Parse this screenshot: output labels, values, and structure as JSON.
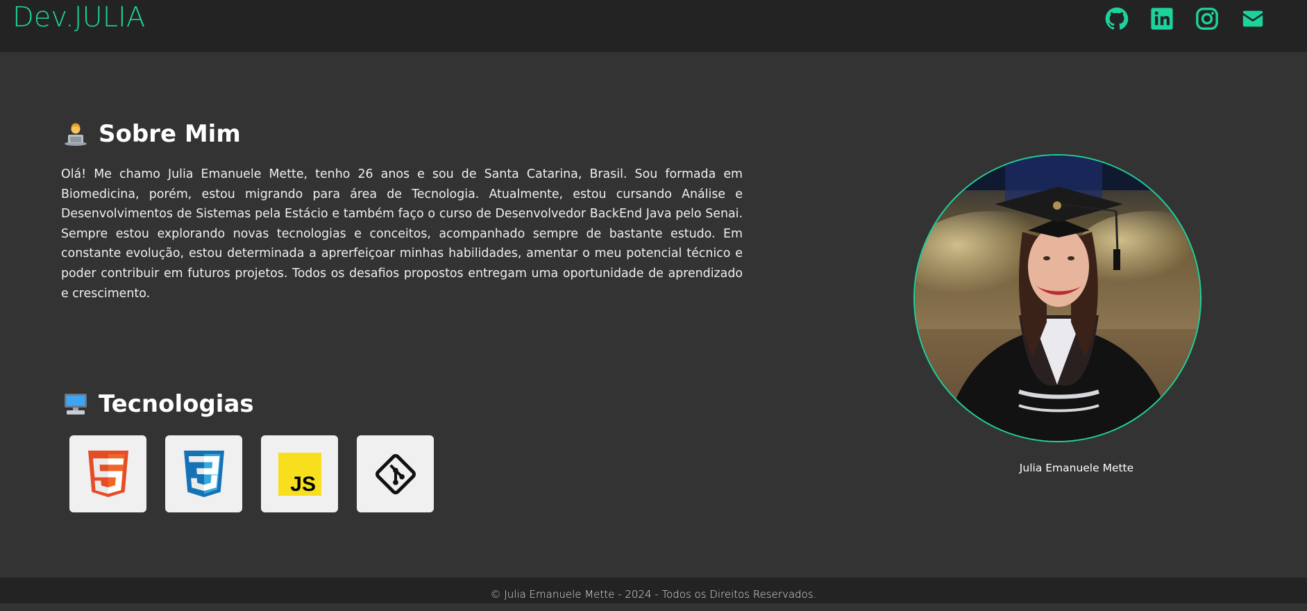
{
  "header": {
    "logo": "Dev.JULIA",
    "social": [
      {
        "icon": "github-icon",
        "label": "GitHub"
      },
      {
        "icon": "linkedin-icon",
        "label": "LinkedIn"
      },
      {
        "icon": "instagram-icon",
        "label": "Instagram"
      },
      {
        "icon": "mail-icon",
        "label": "Email"
      }
    ]
  },
  "about": {
    "emoji": "technologist-emoji",
    "title": "Sobre Mim",
    "text": "Olá! Me chamo Julia Emanuele Mette, tenho 26 anos e sou de Santa Catarina, Brasil. Sou formada em Biomedicina, porém, estou migrando para área de Tecnologia. Atualmente, estou cursando Análise e Desenvolvimentos de Sistemas pela Estácio e também faço o curso de Desenvolvedor BackEnd Java pelo Senai. Sempre estou explorando novas tecnologias e conceitos, acompanhado sempre de bastante estudo. Em constante evolução, estou determinada a aprerfeiçoar minhas habilidades, amentar o meu potencial técnico e poder contribuir em futuros projetos. Todos os desafios propostos entregam uma oportunidade de aprendizado e crescimento."
  },
  "technologies": {
    "emoji": "computer-emoji",
    "title": "Tecnologias",
    "items": [
      {
        "icon": "html5-icon"
      },
      {
        "icon": "css3-icon"
      },
      {
        "icon": "javascript-icon"
      },
      {
        "icon": "git-icon"
      }
    ]
  },
  "profile": {
    "caption": "Julia Emanuele Mette"
  },
  "footer": {
    "text": "© Julia Emanuele Mette - 2024 - Todos os Direitos Reservados."
  },
  "colors": {
    "accent": "#1dd39c",
    "background": "#333333",
    "header": "#232323"
  }
}
